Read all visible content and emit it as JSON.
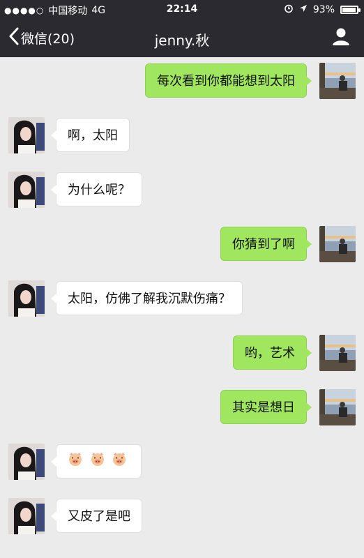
{
  "status_bar": {
    "signal": "●●●●○",
    "carrier": "中国移动",
    "network": "4G",
    "time": "22:14",
    "battery": "93%",
    "battery_level": 0.93
  },
  "header": {
    "back_label": "微信(20)",
    "title": "jenny.秋"
  },
  "messages": [
    {
      "side": "out",
      "text": "每次看到你都能想到太阳"
    },
    {
      "side": "in",
      "text": "啊，太阳"
    },
    {
      "side": "in",
      "text": "为什么呢？"
    },
    {
      "side": "out",
      "text": "你猜到了啊"
    },
    {
      "side": "in",
      "text": "太阳，仿佛了解我沉默伤痛？"
    },
    {
      "side": "out",
      "text": "哟，艺术"
    },
    {
      "side": "out",
      "text": "其实是想日"
    },
    {
      "side": "in",
      "emoji": [
        "pig-face-icon",
        "pig-face-icon",
        "pig-face-icon"
      ]
    },
    {
      "side": "in",
      "text": "又皮了是吧"
    }
  ],
  "colors": {
    "header": "#2b2a30",
    "background": "#ebebeb",
    "outgoing_bubble": "#a0e65e",
    "incoming_bubble": "#ffffff"
  }
}
